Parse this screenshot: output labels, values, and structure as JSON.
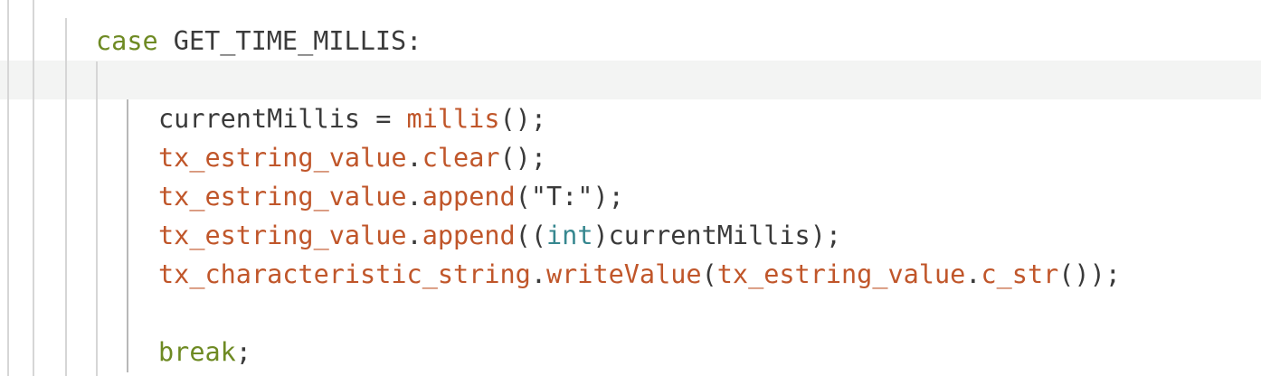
{
  "colors": {
    "keyword": "#6e8a23",
    "function": "#c0562a",
    "type": "#36878f",
    "text": "#3a3a3a",
    "highlight": "#f3f4f3",
    "guide": "#d6d6d6"
  },
  "code": {
    "line1": {
      "kw": "case",
      "rest": " GET_TIME_MILLIS:"
    },
    "line2": {
      "a": "currentMillis = ",
      "b": "millis",
      "c": "();"
    },
    "line3": {
      "a": "tx_estring_value",
      "b": ".",
      "c": "clear",
      "d": "();"
    },
    "line4": {
      "a": "tx_estring_value",
      "b": ".",
      "c": "append",
      "d": "(\"T:\");"
    },
    "line5": {
      "a": "tx_estring_value",
      "b": ".",
      "c": "append",
      "d": "((",
      "e": "int",
      "f": ")currentMillis);"
    },
    "line6": {
      "a": "tx_characteristic_string",
      "b": ".",
      "c": "writeValue",
      "d": "(",
      "e": "tx_estring_value",
      "f": ".",
      "g": "c_str",
      "h": "());"
    },
    "line7": {
      "kw": "break",
      "rest": ";"
    }
  }
}
